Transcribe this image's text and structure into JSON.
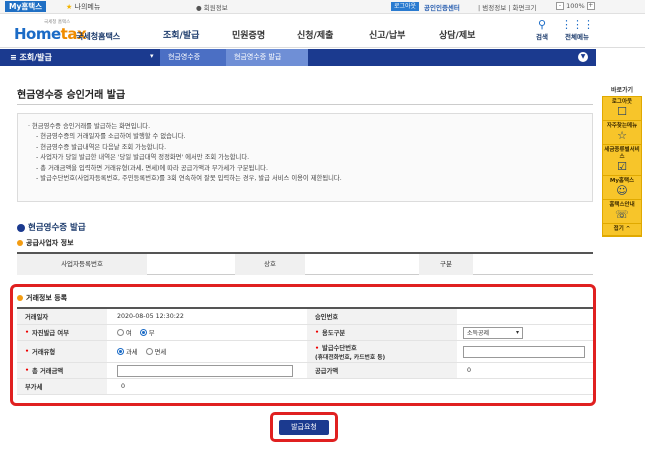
{
  "topbar": {
    "my_hometax": "My홈택스",
    "my_menu": "나의메뉴",
    "user_info": "회원정보",
    "login": "로그아웃",
    "cert_center": "공인인증센터",
    "links": "| 범정정보 | 화면크기",
    "zoom": "100%"
  },
  "header": {
    "logo_tag": "국세청 홈택스",
    "logo_main": "Hometax",
    "logo_sub": "국세청홈택스",
    "menu": [
      "조회/발급",
      "민원증명",
      "신청/제출",
      "신고/납부",
      "상담/제보"
    ],
    "search_label": "검색",
    "all_menu_label": "전체메뉴"
  },
  "navbar": {
    "menu_label": "≡ 조회/발급",
    "crumb2": "현금영수증",
    "crumb3": "현금영수증 발급"
  },
  "side": {
    "title": "바로가기",
    "items": [
      "로그아웃",
      "자주찾는메뉴",
      "세금종류별서비스",
      "My홈택스",
      "홈택스안내"
    ],
    "top": "접기 ^"
  },
  "page": {
    "title": "현금영수증 승인거래 발급",
    "notice": [
      "· 현금영수증 승인거래를 발급하는 화면입니다.",
      "- 현금영수증의 거래일자를 소급하여 발행할 수 없습니다.",
      "- 현금영수증 발급내역은 다음날 조회 가능합니다.",
      "- 사업자가 당일 발급한 내역은 '당일 발급대역 정정화면' 에서만 조회 가능합니다.",
      "- 총 거래금액을 입력하면 거래유형(과세, 면세)에 따라 공급가액과 부가세가 구분됩니다.",
      "- 발급수단번호(사업자등록번호, 주민등록번호)를 3회 연속하여 잘못 입력하는 경우, 발급 서비스 이용이 제한됩니다."
    ],
    "section": "현금영수증 발급",
    "supplier_title": "공급사업자 정보",
    "supplier_headers": [
      "사업자등록번호",
      "상호",
      "구분"
    ],
    "tx_title": "거래정보 등록",
    "tx": {
      "date_label": "거래일자",
      "date_value": "2020-08-05 12:30:22",
      "approval_label": "승인번호",
      "self_issue_label": "자진발급 여부",
      "self_issue_options": [
        "여",
        "부"
      ],
      "usage_label": "용도구분",
      "usage_value": "소득공제",
      "type_label": "거래유형",
      "type_options": [
        "과세",
        "면세"
      ],
      "means_label": "발급수단번호",
      "means_sub": "(휴대전화번호, 카드번호 등)",
      "total_label": "총 거래금액",
      "supply_label": "공급가액",
      "supply_value": "0",
      "vat_label": "부가세",
      "vat_value": "0"
    },
    "submit": "발급요청"
  }
}
